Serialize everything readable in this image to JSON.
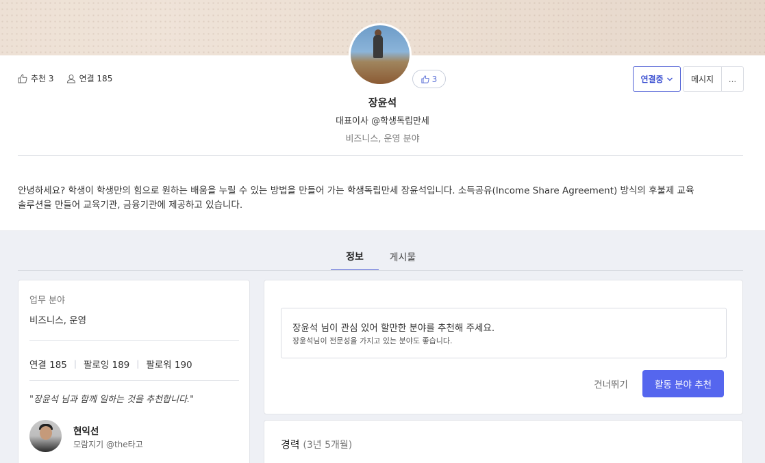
{
  "stats": {
    "likes_label": "추천 3",
    "connections_label": "연결 185"
  },
  "profile": {
    "like_count": "3",
    "name": "장윤석",
    "title": "대표이사 @학생독립만세",
    "field": "비즈니스, 운영 분야",
    "bio_line1": "안녕하세요? 학생이 학생만의 힘으로 원하는 배움을 누릴 수 있는 방법을 만들어 가는 학생독립만세 장윤석입니다. 소득공유(Income Share Agreement) 방식의 후불제 교육",
    "bio_line2": "솔루션을 만들어 교육기관, 금융기관에 제공하고 있습니다."
  },
  "actions": {
    "connect_label": "연결중",
    "message_label": "메시지",
    "more_label": "..."
  },
  "tabs": [
    {
      "label": "정보"
    },
    {
      "label": "게시물"
    }
  ],
  "left_card": {
    "field_label": "업무 분야",
    "field_value": "비즈니스, 운영",
    "connections": "연결 185",
    "following": "팔로잉 189",
    "followers": "팔로워 190",
    "separator": "|",
    "quote": "\"장윤석 님과 함께 일하는 것을 추천합니다.\"",
    "recommender_name": "현익선",
    "recommender_org": "모람지기 @the타고"
  },
  "right_card": {
    "prompt_main": "장윤석 님이 관심 있어 할만한 분야를 추천해 주세요.",
    "prompt_sub": "장윤석님이 전문성을 가지고 있는 분야도 좋습니다.",
    "skip_label": "건너뛰기",
    "recommend_label": "활동 분야 추천"
  },
  "career": {
    "title": "경력",
    "duration": "(3년 5개월)"
  },
  "colors": {
    "accent": "#5566ee",
    "accent_border": "#4a5bd4",
    "background_gray": "#eef0f5"
  },
  "icons": {
    "like": "thumbs-up-icon",
    "connection": "person-icon",
    "dropdown": "chevron-down-icon"
  }
}
